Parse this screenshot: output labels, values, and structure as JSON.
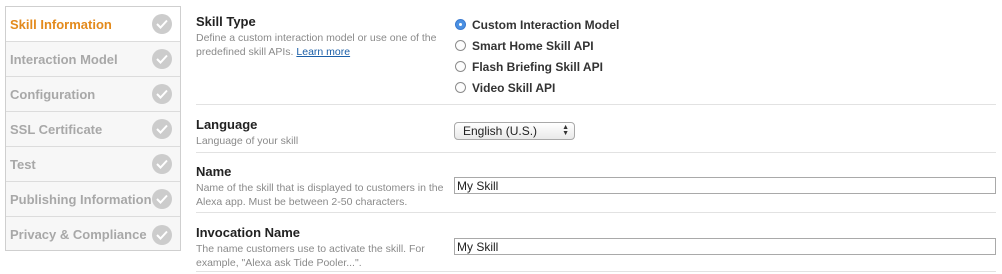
{
  "sidebar": {
    "items": [
      {
        "label": "Skill Information",
        "active": true
      },
      {
        "label": "Interaction Model",
        "active": false
      },
      {
        "label": "Configuration",
        "active": false
      },
      {
        "label": "SSL Certificate",
        "active": false
      },
      {
        "label": "Test",
        "active": false
      },
      {
        "label": "Publishing Information",
        "active": false
      },
      {
        "label": "Privacy & Compliance",
        "active": false
      }
    ],
    "check_icon": "check-icon"
  },
  "skill_type": {
    "title": "Skill Type",
    "description": "Define a custom interaction model or use one of the predefined skill APIs.",
    "learn_more": "Learn more",
    "options": [
      {
        "label": "Custom Interaction Model",
        "selected": true
      },
      {
        "label": "Smart Home Skill API",
        "selected": false
      },
      {
        "label": "Flash Briefing Skill API",
        "selected": false
      },
      {
        "label": "Video Skill API",
        "selected": false
      }
    ]
  },
  "language": {
    "title": "Language",
    "description": "Language of your skill",
    "selected": "English (U.S.)"
  },
  "name": {
    "title": "Name",
    "description": "Name of the skill that is displayed to customers in the Alexa app. Must be between 2-50 characters.",
    "value": "My Skill"
  },
  "invocation_name": {
    "title": "Invocation Name",
    "description": "The name customers use to activate the skill. For example, \"Alexa ask Tide Pooler...\".",
    "value": "My Skill"
  },
  "colors": {
    "active_nav": "#e38a1c",
    "inactive_nav": "#a8a8a8",
    "link": "#1b5fa8",
    "radio_selected": "#4a90e2"
  }
}
